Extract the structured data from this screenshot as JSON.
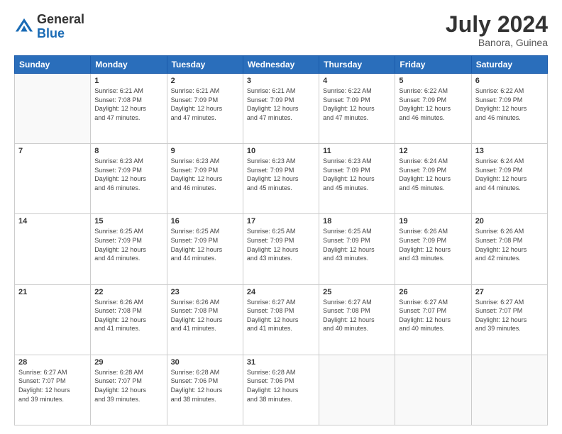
{
  "header": {
    "logo": {
      "general": "General",
      "blue": "Blue"
    },
    "title": "July 2024",
    "subtitle": "Banora, Guinea"
  },
  "calendar": {
    "days_of_week": [
      "Sunday",
      "Monday",
      "Tuesday",
      "Wednesday",
      "Thursday",
      "Friday",
      "Saturday"
    ],
    "weeks": [
      [
        {
          "day": "",
          "info": ""
        },
        {
          "day": "1",
          "info": "Sunrise: 6:21 AM\nSunset: 7:08 PM\nDaylight: 12 hours\nand 47 minutes."
        },
        {
          "day": "2",
          "info": "Sunrise: 6:21 AM\nSunset: 7:09 PM\nDaylight: 12 hours\nand 47 minutes."
        },
        {
          "day": "3",
          "info": "Sunrise: 6:21 AM\nSunset: 7:09 PM\nDaylight: 12 hours\nand 47 minutes."
        },
        {
          "day": "4",
          "info": "Sunrise: 6:22 AM\nSunset: 7:09 PM\nDaylight: 12 hours\nand 47 minutes."
        },
        {
          "day": "5",
          "info": "Sunrise: 6:22 AM\nSunset: 7:09 PM\nDaylight: 12 hours\nand 46 minutes."
        },
        {
          "day": "6",
          "info": "Sunrise: 6:22 AM\nSunset: 7:09 PM\nDaylight: 12 hours\nand 46 minutes."
        }
      ],
      [
        {
          "day": "7",
          "info": ""
        },
        {
          "day": "8",
          "info": "Sunrise: 6:23 AM\nSunset: 7:09 PM\nDaylight: 12 hours\nand 46 minutes."
        },
        {
          "day": "9",
          "info": "Sunrise: 6:23 AM\nSunset: 7:09 PM\nDaylight: 12 hours\nand 46 minutes."
        },
        {
          "day": "10",
          "info": "Sunrise: 6:23 AM\nSunset: 7:09 PM\nDaylight: 12 hours\nand 45 minutes."
        },
        {
          "day": "11",
          "info": "Sunrise: 6:23 AM\nSunset: 7:09 PM\nDaylight: 12 hours\nand 45 minutes."
        },
        {
          "day": "12",
          "info": "Sunrise: 6:24 AM\nSunset: 7:09 PM\nDaylight: 12 hours\nand 45 minutes."
        },
        {
          "day": "13",
          "info": "Sunrise: 6:24 AM\nSunset: 7:09 PM\nDaylight: 12 hours\nand 44 minutes."
        }
      ],
      [
        {
          "day": "14",
          "info": ""
        },
        {
          "day": "15",
          "info": "Sunrise: 6:25 AM\nSunset: 7:09 PM\nDaylight: 12 hours\nand 44 minutes."
        },
        {
          "day": "16",
          "info": "Sunrise: 6:25 AM\nSunset: 7:09 PM\nDaylight: 12 hours\nand 44 minutes."
        },
        {
          "day": "17",
          "info": "Sunrise: 6:25 AM\nSunset: 7:09 PM\nDaylight: 12 hours\nand 43 minutes."
        },
        {
          "day": "18",
          "info": "Sunrise: 6:25 AM\nSunset: 7:09 PM\nDaylight: 12 hours\nand 43 minutes."
        },
        {
          "day": "19",
          "info": "Sunrise: 6:26 AM\nSunset: 7:09 PM\nDaylight: 12 hours\nand 43 minutes."
        },
        {
          "day": "20",
          "info": "Sunrise: 6:26 AM\nSunset: 7:08 PM\nDaylight: 12 hours\nand 42 minutes."
        }
      ],
      [
        {
          "day": "21",
          "info": ""
        },
        {
          "day": "22",
          "info": "Sunrise: 6:26 AM\nSunset: 7:08 PM\nDaylight: 12 hours\nand 41 minutes."
        },
        {
          "day": "23",
          "info": "Sunrise: 6:26 AM\nSunset: 7:08 PM\nDaylight: 12 hours\nand 41 minutes."
        },
        {
          "day": "24",
          "info": "Sunrise: 6:27 AM\nSunset: 7:08 PM\nDaylight: 12 hours\nand 41 minutes."
        },
        {
          "day": "25",
          "info": "Sunrise: 6:27 AM\nSunset: 7:08 PM\nDaylight: 12 hours\nand 40 minutes."
        },
        {
          "day": "26",
          "info": "Sunrise: 6:27 AM\nSunset: 7:07 PM\nDaylight: 12 hours\nand 40 minutes."
        },
        {
          "day": "27",
          "info": "Sunrise: 6:27 AM\nSunset: 7:07 PM\nDaylight: 12 hours\nand 39 minutes."
        }
      ],
      [
        {
          "day": "28",
          "info": "Sunrise: 6:27 AM\nSunset: 7:07 PM\nDaylight: 12 hours\nand 39 minutes."
        },
        {
          "day": "29",
          "info": "Sunrise: 6:28 AM\nSunset: 7:07 PM\nDaylight: 12 hours\nand 39 minutes."
        },
        {
          "day": "30",
          "info": "Sunrise: 6:28 AM\nSunset: 7:06 PM\nDaylight: 12 hours\nand 38 minutes."
        },
        {
          "day": "31",
          "info": "Sunrise: 6:28 AM\nSunset: 7:06 PM\nDaylight: 12 hours\nand 38 minutes."
        },
        {
          "day": "",
          "info": ""
        },
        {
          "day": "",
          "info": ""
        },
        {
          "day": "",
          "info": ""
        }
      ]
    ]
  }
}
